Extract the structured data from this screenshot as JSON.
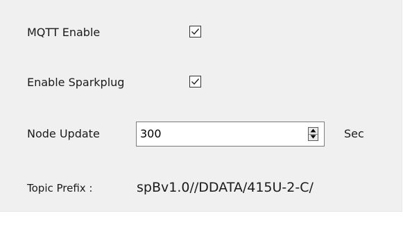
{
  "settings": {
    "mqtt_enable": {
      "label": "MQTT Enable",
      "checked": true
    },
    "enable_sparkplug": {
      "label": "Enable Sparkplug",
      "checked": true
    },
    "node_update": {
      "label": "Node Update",
      "value": "300",
      "unit": "Sec"
    },
    "topic_prefix": {
      "label": "Topic Prefix :",
      "value": "spBv1.0//DDATA/415U-2-C/"
    }
  }
}
